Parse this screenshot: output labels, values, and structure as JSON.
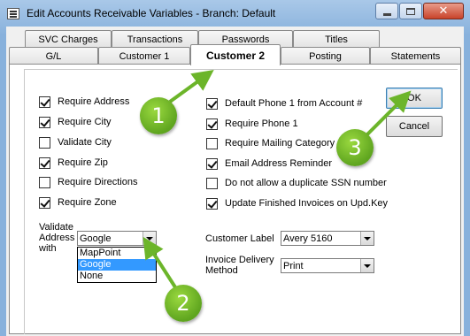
{
  "window": {
    "title": "Edit Accounts Receivable Variables  - Branch: Default",
    "close_glyph": "✕"
  },
  "tabs_back": [
    "SVC Charges",
    "Transactions",
    "Passwords",
    "Titles"
  ],
  "tabs_front": [
    "G/L",
    "Customer 1",
    "Customer 2",
    "Posting",
    "Statements"
  ],
  "active_tab": "Customer 2",
  "left_checks": [
    {
      "label": "Require Address",
      "checked": true
    },
    {
      "label": "Require City",
      "checked": true
    },
    {
      "label": "Validate City",
      "checked": false
    },
    {
      "label": "Require Zip",
      "checked": true
    },
    {
      "label": "Require Directions",
      "checked": false
    },
    {
      "label": "Require Zone",
      "checked": true
    }
  ],
  "right_checks": [
    {
      "label": "Default Phone 1 from Account #",
      "checked": true
    },
    {
      "label": "Require Phone 1",
      "checked": true
    },
    {
      "label": "Require Mailing Category",
      "checked": false
    },
    {
      "label": "Email Address Reminder",
      "checked": true
    },
    {
      "label": "Do not allow a duplicate SSN number",
      "checked": false
    },
    {
      "label": "Update Finished Invoices on Upd.Key",
      "checked": true
    }
  ],
  "buttons": {
    "ok": "OK",
    "cancel": "Cancel"
  },
  "validate_address": {
    "label_line1": "Validate",
    "label_line2": "Address",
    "label_line3": "with",
    "value": "Google",
    "options": [
      "MapPoint",
      "Google",
      "None"
    ],
    "selected": "Google"
  },
  "customer_label": {
    "label": "Customer Label",
    "value": "Avery 5160"
  },
  "invoice_delivery": {
    "label_line1": "Invoice Delivery",
    "label_line2": "Method",
    "value": "Print"
  },
  "callouts": [
    "1",
    "2",
    "3"
  ],
  "colors": {
    "callout": "#6cb52a",
    "selection": "#3399ff"
  }
}
